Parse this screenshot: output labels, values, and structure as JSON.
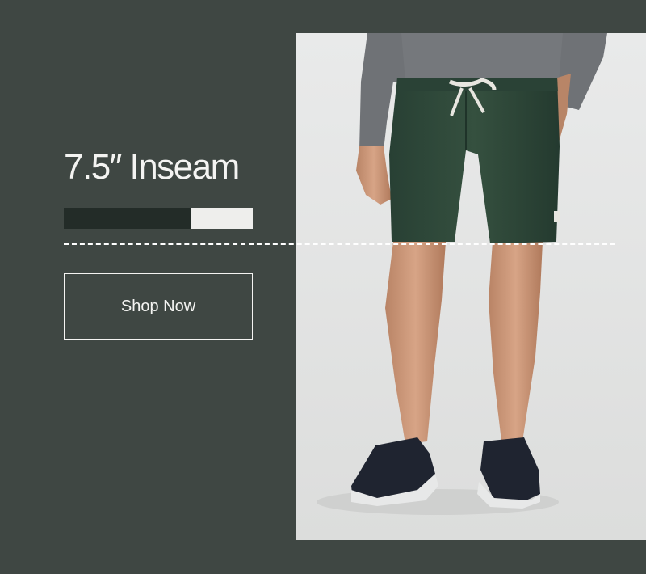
{
  "headline": "7.5″ Inseam",
  "inseam_bar": {
    "fill_fraction": 0.67
  },
  "cta": {
    "label": "Shop Now"
  },
  "colors": {
    "background": "#3f4743",
    "bar_dark": "#232c28",
    "bar_light": "#eeeeec",
    "shorts": "#2f473b"
  },
  "photo": {
    "subject": "product-photo-shorts"
  }
}
